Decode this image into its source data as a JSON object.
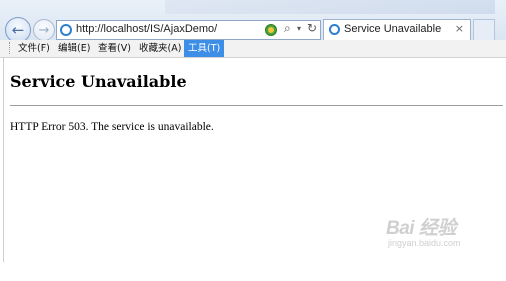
{
  "browser": {
    "address": "http://localhost/IS/AjaxDemo/",
    "tab_title": "Service Unavailable",
    "tab_close": "×",
    "back_glyph": "←",
    "forward_glyph": "→",
    "search_glyph": "⌕",
    "drop_glyph": "▾",
    "refresh_glyph": "↻"
  },
  "menu": {
    "items": [
      "文件(F)",
      "编辑(E)",
      "查看(V)",
      "收藏夹(A)",
      "工具(T)"
    ],
    "active": "工具(T)"
  },
  "page": {
    "title": "Service Unavailable",
    "message": "HTTP Error 503. The service is unavailable."
  },
  "watermark": {
    "logo": "Bai 经验",
    "url": "jingyan.baidu.com"
  },
  "colors": {
    "menu_active": "#3d8ee6",
    "chrome_top": "#e9f0f8",
    "ie_blue": "#2e7fd0"
  },
  "icons": [
    "back-arrow-icon",
    "forward-arrow-icon",
    "ie-page-icon",
    "compatibility-view-icon",
    "search-icon",
    "refresh-icon",
    "tab-close-icon"
  ]
}
